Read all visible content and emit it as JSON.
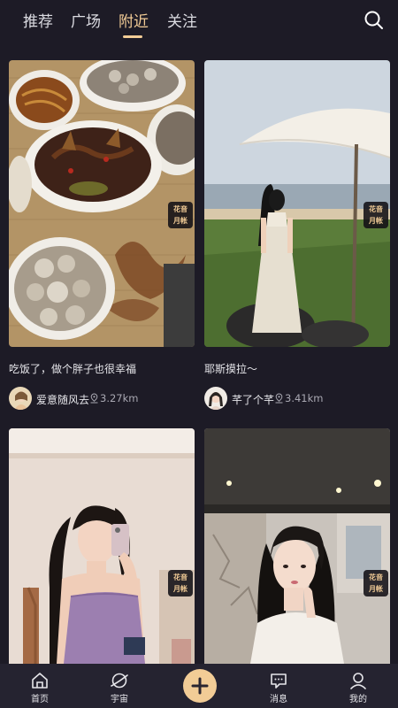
{
  "tabs": [
    {
      "label": "推荐"
    },
    {
      "label": "广场"
    },
    {
      "label": "附近"
    },
    {
      "label": "关注"
    }
  ],
  "active_tab": "附近",
  "badge": {
    "line1": "花音",
    "line2": "月帐"
  },
  "cards": [
    {
      "title": "吃饭了，做个胖子也很幸福",
      "user": "爱意随风去",
      "distance": "3.27km"
    },
    {
      "title": "耶斯摸拉～",
      "user": "芊了个芊",
      "distance": "3.41km"
    },
    {
      "title": "",
      "user": "",
      "distance": ""
    },
    {
      "title": "",
      "user": "",
      "distance": ""
    }
  ],
  "nav": [
    {
      "label": "首页",
      "icon": "home-icon"
    },
    {
      "label": "宇宙",
      "icon": "planet-icon"
    },
    {
      "label": "",
      "icon": "plus-icon"
    },
    {
      "label": "消息",
      "icon": "message-icon"
    },
    {
      "label": "我的",
      "icon": "profile-icon"
    }
  ],
  "colors": {
    "accent": "#f2cc96",
    "background": "#1d1b26",
    "nav_background": "#252330"
  }
}
